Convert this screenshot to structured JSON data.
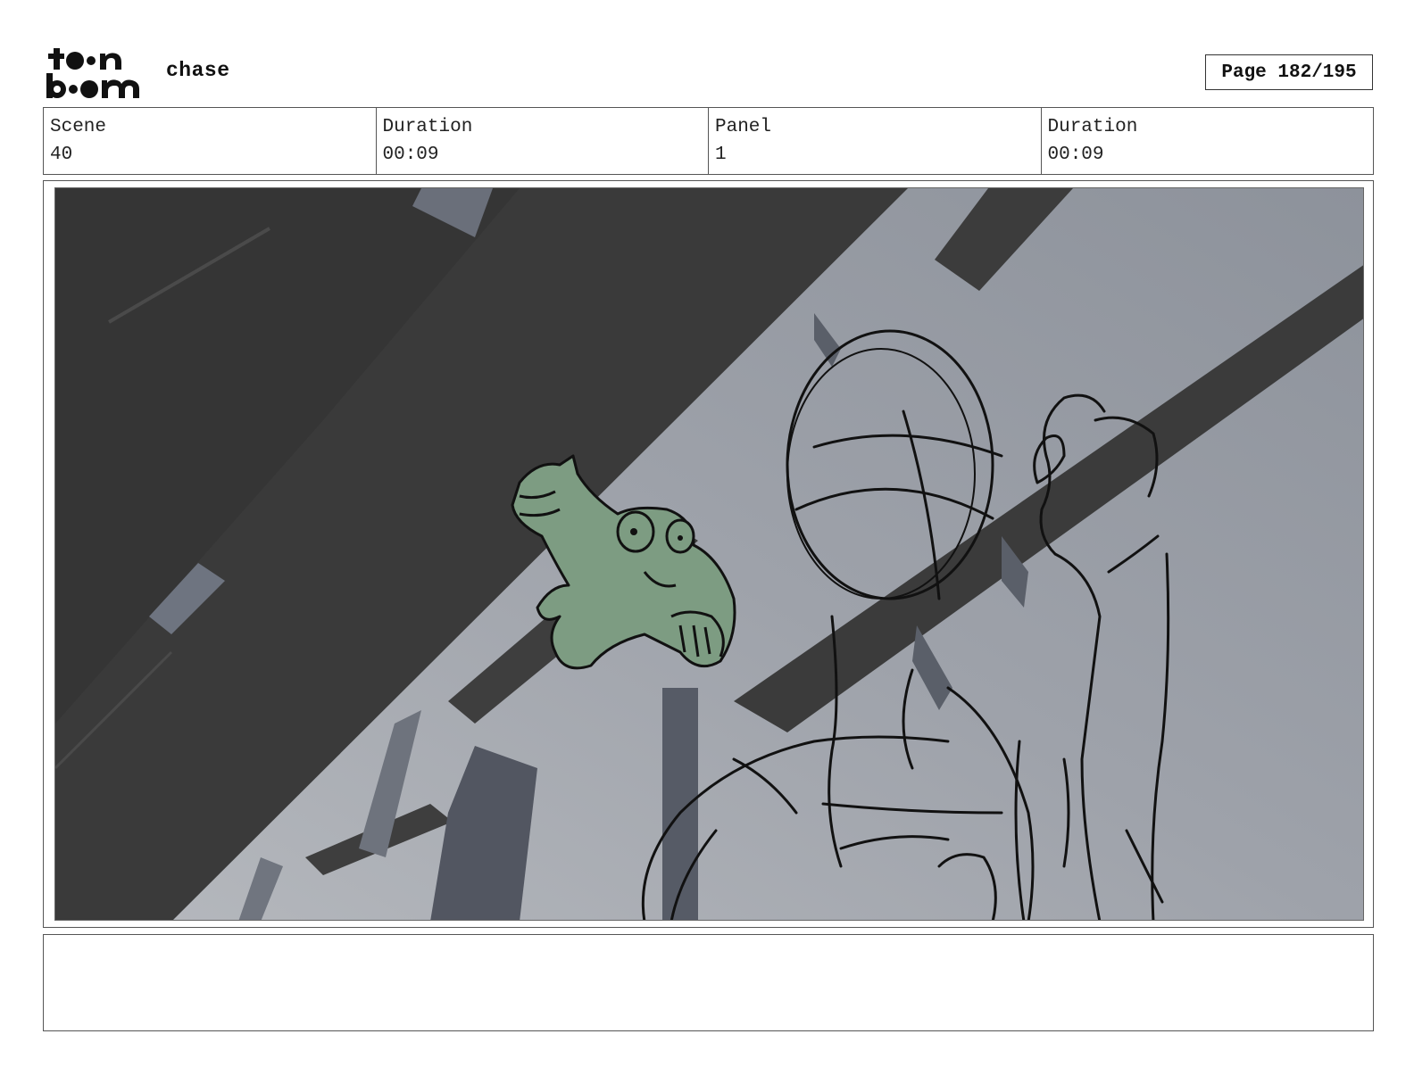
{
  "header": {
    "logo_name": "toon boom",
    "project_title": "chase",
    "page_label": "Page 182/195"
  },
  "info": {
    "scene_label": "Scene",
    "scene_value": "40",
    "scene_duration_label": "Duration",
    "scene_duration_value": "00:09",
    "panel_label": "Panel",
    "panel_value": "1",
    "panel_duration_label": "Duration",
    "panel_duration_value": "00:09"
  },
  "panel": {
    "colors": {
      "dark_block": "#3a3a3a",
      "light_wall": "#9a9ea6",
      "frog": "#7d9c82",
      "sketch_line": "#111111"
    }
  },
  "notes": {
    "text": ""
  }
}
